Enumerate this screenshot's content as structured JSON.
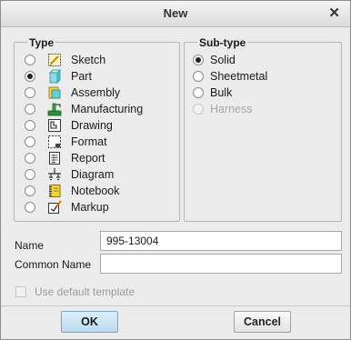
{
  "dialog": {
    "title": "New"
  },
  "type_group": {
    "legend": "Type",
    "items": [
      {
        "label": "Sketch",
        "icon": "sketch-icon",
        "selected": false
      },
      {
        "label": "Part",
        "icon": "part-icon",
        "selected": true
      },
      {
        "label": "Assembly",
        "icon": "assembly-icon",
        "selected": false
      },
      {
        "label": "Manufacturing",
        "icon": "manufacturing-icon",
        "selected": false
      },
      {
        "label": "Drawing",
        "icon": "drawing-icon",
        "selected": false
      },
      {
        "label": "Format",
        "icon": "format-icon",
        "selected": false
      },
      {
        "label": "Report",
        "icon": "report-icon",
        "selected": false
      },
      {
        "label": "Diagram",
        "icon": "diagram-icon",
        "selected": false
      },
      {
        "label": "Notebook",
        "icon": "notebook-icon",
        "selected": false
      },
      {
        "label": "Markup",
        "icon": "markup-icon",
        "selected": false
      }
    ]
  },
  "subtype_group": {
    "legend": "Sub-type",
    "items": [
      {
        "label": "Solid",
        "selected": true,
        "enabled": true
      },
      {
        "label": "Sheetmetal",
        "selected": false,
        "enabled": true
      },
      {
        "label": "Bulk",
        "selected": false,
        "enabled": true
      },
      {
        "label": "Harness",
        "selected": false,
        "enabled": false
      }
    ]
  },
  "fields": {
    "name_label": "Name",
    "name_value": "995-13004",
    "common_name_label": "Common Name",
    "common_name_value": ""
  },
  "template": {
    "label": "Use default template",
    "checked": false,
    "enabled": false
  },
  "buttons": {
    "ok": "OK",
    "cancel": "Cancel"
  }
}
